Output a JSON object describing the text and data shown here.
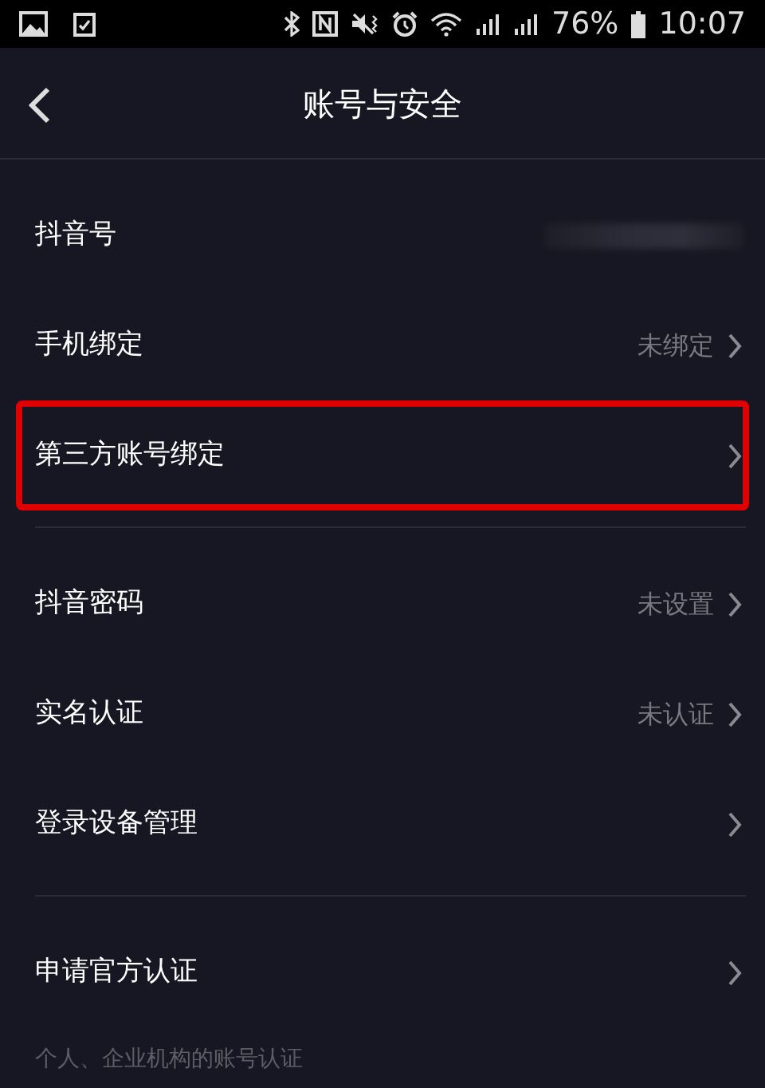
{
  "status_bar": {
    "battery": "76%",
    "time": "10:07"
  },
  "header": {
    "title": "账号与安全"
  },
  "groups": [
    {
      "rows": [
        {
          "label": "抖音号",
          "redacted": true,
          "chevron": false,
          "highlighted": false
        },
        {
          "label": "手机绑定",
          "value": "未绑定",
          "redacted": false,
          "chevron": true,
          "highlighted": false
        },
        {
          "label": "第三方账号绑定",
          "redacted": false,
          "chevron": true,
          "highlighted": true
        }
      ]
    },
    {
      "rows": [
        {
          "label": "抖音密码",
          "value": "未设置",
          "redacted": false,
          "chevron": true,
          "highlighted": false
        },
        {
          "label": "实名认证",
          "value": "未认证",
          "redacted": false,
          "chevron": true,
          "highlighted": false
        },
        {
          "label": "登录设备管理",
          "redacted": false,
          "chevron": true,
          "highlighted": false
        }
      ]
    },
    {
      "rows": [
        {
          "label": "申请官方认证",
          "redacted": false,
          "chevron": true,
          "highlighted": false
        }
      ],
      "note": "个人、企业机构的账号认证"
    }
  ]
}
